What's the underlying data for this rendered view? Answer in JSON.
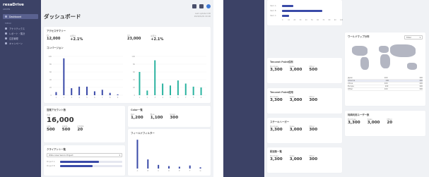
{
  "left": {
    "sidebar": {
      "brand": "resaDrive",
      "brand_sub": "ADMIN",
      "items": [
        {
          "label": "Dashboard",
          "active": true
        },
        {
          "label": "アナリティクス"
        },
        {
          "label": "レポート・集計"
        },
        {
          "label": "広告管理"
        },
        {
          "label": "キャンペーン"
        }
      ],
      "section": "MENU"
    },
    "page_title": "ダッシュボード",
    "page_sub": [
      "Last update 0:00",
      "2020/01/01 00:00"
    ],
    "accessCard": {
      "title": "アクセスサマリー",
      "stats": [
        {
          "label": "PV",
          "value": "12,000",
          "delta_label": "前月比",
          "delta": "+2.1%"
        },
        {
          "label": "UU",
          "value": "23,000",
          "delta_label": "前月比",
          "delta": "+2.1%"
        }
      ]
    },
    "conversionCard": {
      "title": "コンバージョン"
    },
    "chartA": {
      "values": [
        8,
        95,
        18,
        22,
        22,
        10,
        14,
        6,
        2
      ],
      "labels": [
        "1",
        "2",
        "3",
        "4",
        "5",
        "6",
        "7",
        "8",
        "9"
      ],
      "ticks": [
        "100",
        "80",
        "60",
        "40",
        "20",
        "0"
      ]
    },
    "chartB": {
      "values": [
        60,
        12,
        90,
        30,
        25,
        38,
        30,
        22,
        20
      ],
      "labels": [
        "1",
        "2",
        "3",
        "4",
        "5",
        "6",
        "7",
        "8",
        "9"
      ],
      "ticks": [
        "100",
        "80",
        "60",
        "40",
        "20",
        "0"
      ]
    },
    "bizCard": {
      "title": "営業アカウント数",
      "label": "合計",
      "value": "16,000",
      "stats": [
        {
          "label": "ADS",
          "value": "500"
        },
        {
          "label": "COMS",
          "value": "500"
        },
        {
          "label": "OTHER",
          "value": "20"
        }
      ]
    },
    "colorCard": {
      "title": "Color一覧",
      "stats": [
        {
          "label": "Red",
          "value": "1,200"
        },
        {
          "label": "Blue",
          "value": "1,100"
        },
        {
          "label": "Green",
          "value": "300"
        }
      ]
    },
    "clientCard": {
      "title": "クライアント一覧",
      "select": "Wide Area Sanrio Project",
      "rows": [
        {
          "label": "Project A",
          "pct": 0.62
        },
        {
          "label": "Project B",
          "pct": 0.52
        }
      ]
    },
    "filterCard": {
      "title": "フィールドフィルター",
      "chart": {
        "values": [
          95,
          30,
          12,
          8,
          6,
          10,
          4
        ],
        "labels": [
          "A",
          "B",
          "C",
          "D",
          "E",
          "F",
          "G"
        ]
      }
    }
  },
  "right": {
    "topChart": {
      "rows": [
        {
          "label": "Item A",
          "pct": 0.2
        },
        {
          "label": "Item B",
          "pct": 0.7
        },
        {
          "label": "Item C",
          "pct": 0.12
        }
      ],
      "ticks": [
        "0",
        "10",
        "20",
        "30",
        "40",
        "50",
        "60",
        "70",
        "80",
        "90",
        "100"
      ]
    },
    "mapCard": {
      "title": "ワールドマップ分布",
      "select": "Total",
      "rows": [
        {
          "c": "Japan",
          "a": "100",
          "b": "100"
        },
        {
          "c": "America",
          "a": "100",
          "b": "100"
        },
        {
          "c": "China",
          "a": "100",
          "b": "100"
        },
        {
          "c": "Europe",
          "a": "100",
          "b": "100"
        },
        {
          "c": "Other",
          "a": "100",
          "b": "100"
        }
      ]
    },
    "cards": [
      {
        "title": "Tencent Point保有",
        "stats": [
          {
            "label": "Purchase",
            "value": "3,300"
          },
          {
            "label": "Sales",
            "value": "3,000"
          },
          {
            "label": "Other",
            "value": "500"
          }
        ]
      },
      {
        "title": "Tencent Point使用",
        "stats": [
          {
            "label": "Purchase",
            "value": "3,300"
          },
          {
            "label": "Sales",
            "value": "3,000"
          },
          {
            "label": "Other",
            "value": "300"
          }
        ]
      },
      {
        "title": "ステーキハーガー",
        "stats": [
          {
            "label": "Purchase",
            "value": "3,300"
          },
          {
            "label": "Sales",
            "value": "3,000"
          },
          {
            "label": "Other",
            "value": "300"
          }
        ]
      },
      {
        "title": "配送数一覧",
        "stats": [
          {
            "label": "Purchase",
            "value": "3,300"
          },
          {
            "label": "Sales",
            "value": "3,000"
          },
          {
            "label": "Other",
            "value": "300"
          }
        ]
      }
    ],
    "activeCard": {
      "title": "特典利用ユーザー数",
      "stats": [
        {
          "label": "Purchase",
          "value": "3,300"
        },
        {
          "label": "Sales",
          "value": "3,000"
        },
        {
          "label": "Other",
          "value": "20"
        }
      ]
    }
  },
  "colors": {
    "accent": "#3a4aa8",
    "teal": "#2bb3a0",
    "sidebar": "#3c4266",
    "bg": "#f0f2f5"
  }
}
